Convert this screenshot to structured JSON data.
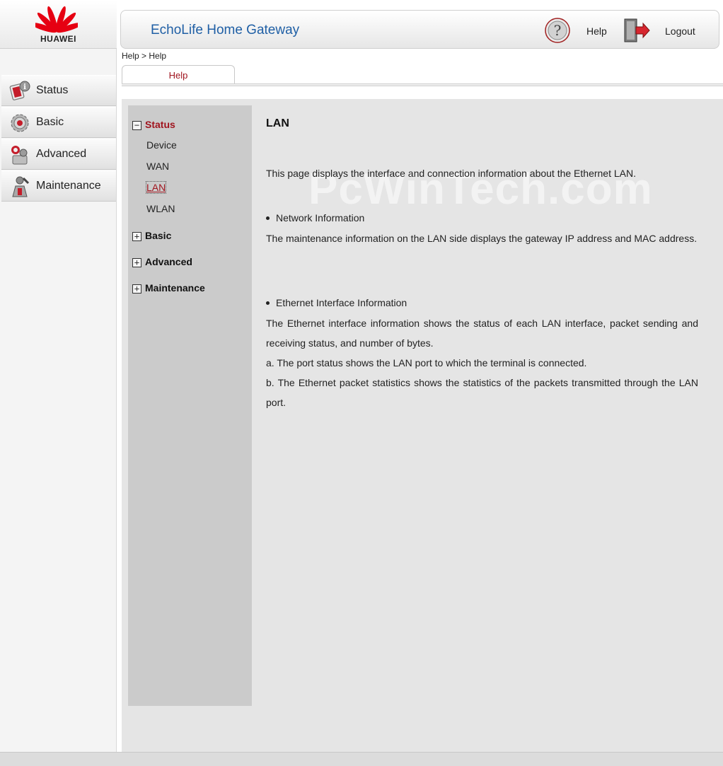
{
  "brand": {
    "logo_text": "HUAWEI",
    "logo_color": "#e60012"
  },
  "sidebar": {
    "items": [
      {
        "label": "Status",
        "icon": "status-info-icon"
      },
      {
        "label": "Basic",
        "icon": "gear-icon"
      },
      {
        "label": "Advanced",
        "icon": "advanced-tools-icon"
      },
      {
        "label": "Maintenance",
        "icon": "wrench-person-icon"
      }
    ]
  },
  "header": {
    "title": "EchoLife Home Gateway",
    "help_label": "Help",
    "logout_label": "Logout",
    "title_color": "#1f5fa5"
  },
  "breadcrumb": "Help > Help",
  "tab": {
    "label": "Help"
  },
  "tree": {
    "sections": [
      {
        "label": "Status",
        "toggle": "−",
        "expanded": true
      },
      {
        "label": "Basic",
        "toggle": "+",
        "expanded": false
      },
      {
        "label": "Advanced",
        "toggle": "+",
        "expanded": false
      },
      {
        "label": "Maintenance",
        "toggle": "+",
        "expanded": false
      }
    ],
    "status_items": [
      "Device",
      "WAN",
      "LAN",
      "WLAN"
    ],
    "selected": "LAN",
    "accent_color": "#a0141e"
  },
  "help": {
    "title": "LAN",
    "intro": "This page displays the interface and connection information about the Ethernet LAN.",
    "network_heading": "Network Information",
    "network_text": "The maintenance information on the LAN side displays the gateway IP address and MAC address.",
    "ethernet_heading": "Ethernet Interface Information",
    "ethernet_text": "The Ethernet interface information shows the status of each LAN interface, packet sending and receiving status, and number of bytes.",
    "ethernet_a": "a. The port status shows the LAN port to which the terminal is connected.",
    "ethernet_b": "b. The Ethernet packet statistics shows the statistics of the packets transmitted through the LAN port."
  },
  "watermark": "PcWinTech.com"
}
